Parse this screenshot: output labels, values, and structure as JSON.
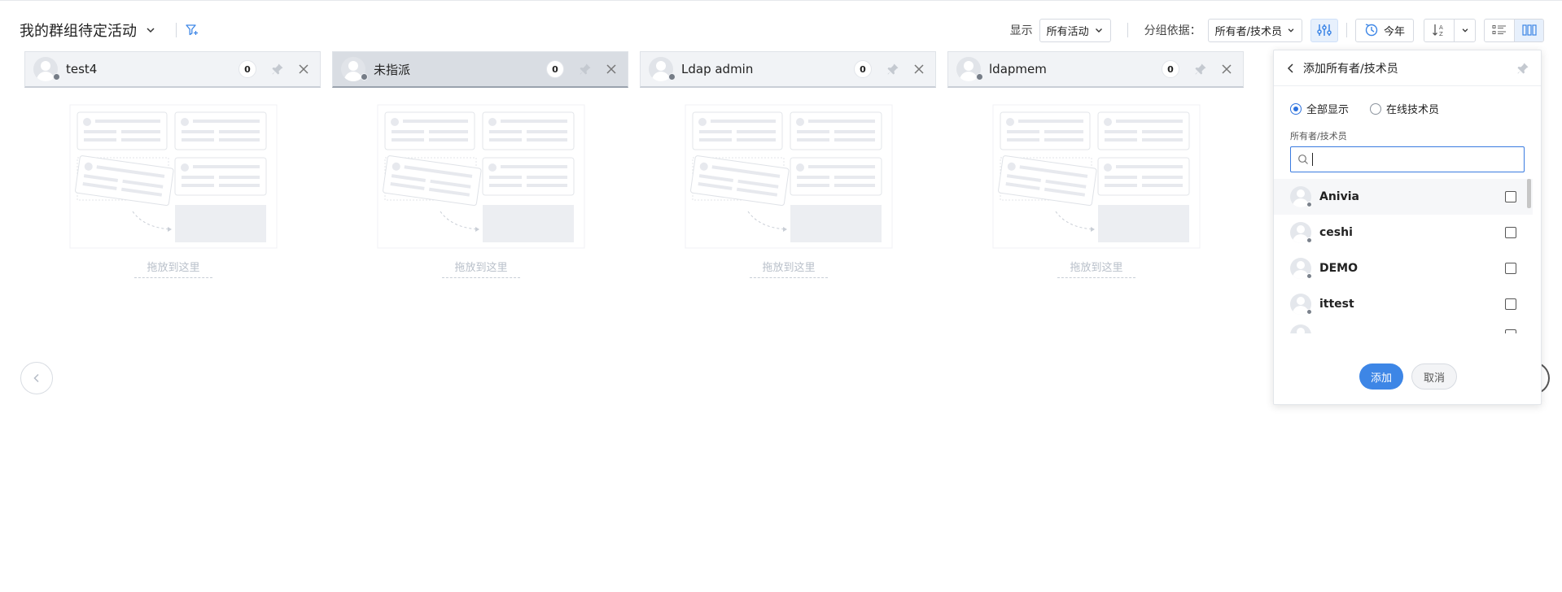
{
  "header": {
    "title": "我的群组待定活动",
    "show_label": "显示",
    "show_value": "所有活动",
    "group_by_label": "分组依据：",
    "group_by_value": "所有者/技术员",
    "period_label": "今年",
    "sort_icon": "sort-az-icon",
    "views": [
      "list-view-icon",
      "column-view-icon"
    ],
    "active_view": "column-view-icon"
  },
  "columns": [
    {
      "name": "test4",
      "count": "0",
      "active": false
    },
    {
      "name": "未指派",
      "count": "0",
      "active": true
    },
    {
      "name": "Ldap admin",
      "count": "0",
      "active": false
    },
    {
      "name": "ldapmem",
      "count": "0",
      "active": false
    }
  ],
  "drop_hint": "拖放到这里",
  "panel": {
    "title": "添加所有者/技术员",
    "radio_all": "全部显示",
    "radio_online": "在线技术员",
    "selected_radio": "all",
    "field_label": "所有者/技术员",
    "search_value": "",
    "items": [
      {
        "name": "Anivia",
        "checked": false
      },
      {
        "name": "ceshi",
        "checked": false
      },
      {
        "name": "DEMO",
        "checked": false
      },
      {
        "name": "ittest",
        "checked": false
      }
    ],
    "add_label": "添加",
    "cancel_label": "取消"
  },
  "colors": {
    "accent": "#3d86e6",
    "header_bg": "#f1f3f6",
    "active_header_bg": "#d9dde3",
    "status_dot": "#767d87"
  }
}
